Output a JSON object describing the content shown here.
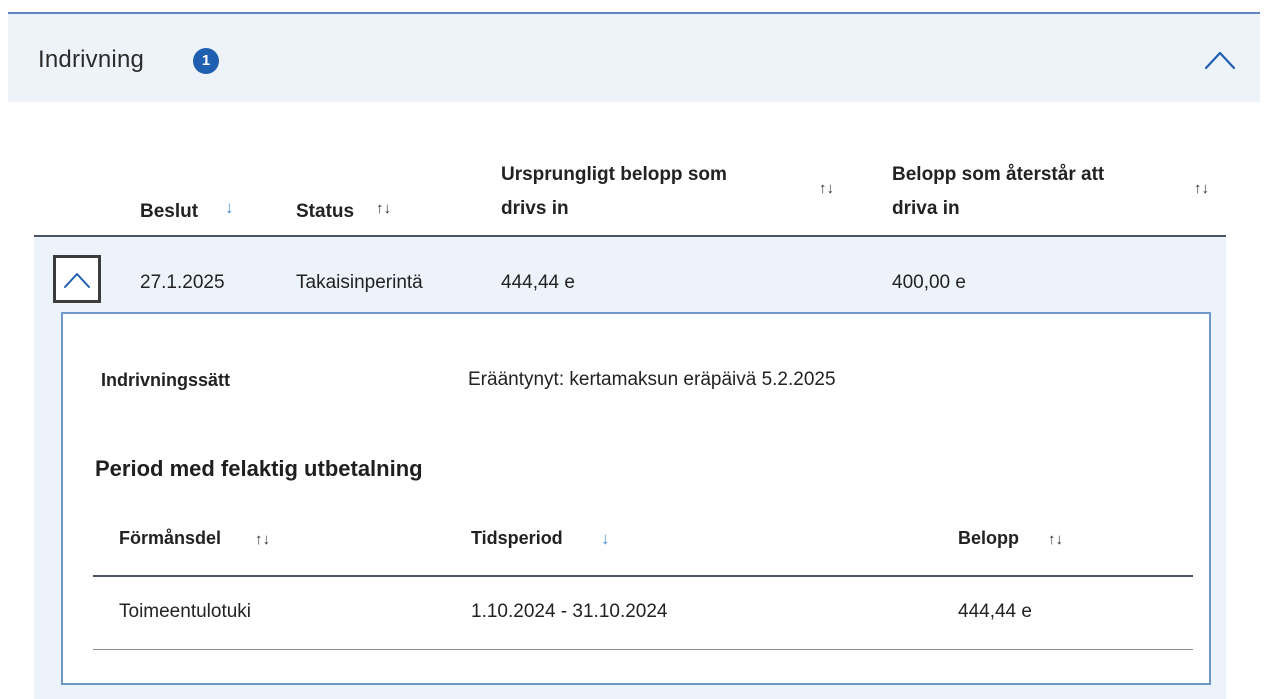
{
  "panel": {
    "title": "Indrivning",
    "badge_count": "1",
    "collapse_icon": "chevron-up-icon"
  },
  "table": {
    "columns": [
      {
        "label": "Beslut",
        "sort": "↓"
      },
      {
        "label": "Status",
        "sort": "↑↓"
      },
      {
        "label_line1": "Ursprungligt belopp som",
        "label_line2": "drivs in",
        "sort": "↑↓"
      },
      {
        "label_line1": "Belopp som återstår att",
        "label_line2": "driva in",
        "sort": "↑↓"
      }
    ],
    "rows": [
      {
        "decision": "27.1.2025",
        "status": "Takaisinperintä",
        "original": "444,44 e",
        "remaining": "400,00 e"
      }
    ]
  },
  "details": {
    "method_label": "Indrivningssätt",
    "method_value": "Erääntynyt: kertamaksun eräpäivä 5.2.2025",
    "period_title": "Period med felaktig utbetalning",
    "columns": [
      {
        "label": "Förmånsdel",
        "sort": "↑↓"
      },
      {
        "label": "Tidsperiod",
        "sort": "↓"
      },
      {
        "label": "Belopp",
        "sort": "↑↓"
      }
    ],
    "rows": [
      {
        "benefit": "Toimeentulotuki",
        "period": "1.10.2024 - 31.10.2024",
        "amount": "444,44 e"
      }
    ]
  },
  "colors": {
    "accent": "#1f5fb0",
    "header_bg": "#eef3fa",
    "card_border": "#6f98c9",
    "sort_active": "#4a8fd8"
  }
}
